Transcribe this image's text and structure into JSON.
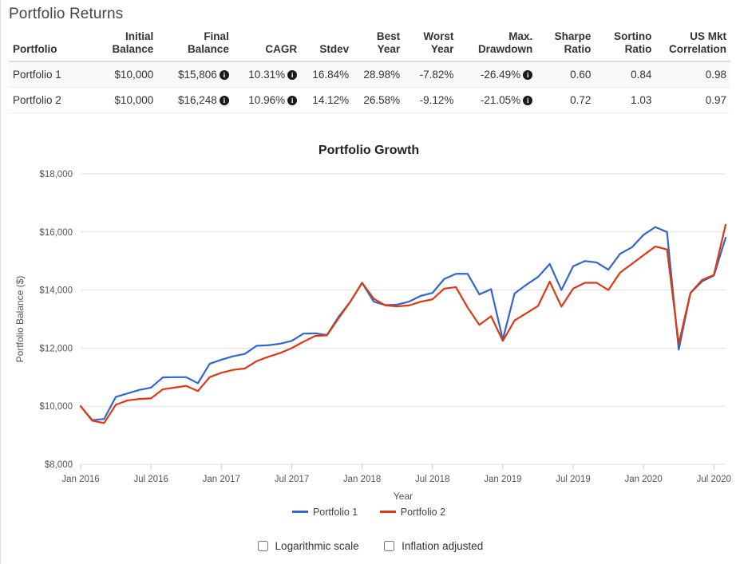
{
  "page": {
    "title": "Portfolio Returns"
  },
  "table": {
    "columns": [
      {
        "key": "portfolio",
        "label": "Portfolio",
        "align": "left"
      },
      {
        "key": "initial_balance",
        "label": "Initial\nBalance",
        "align": "right"
      },
      {
        "key": "final_balance",
        "label": "Final\nBalance",
        "align": "right"
      },
      {
        "key": "cagr",
        "label": "CAGR",
        "align": "right"
      },
      {
        "key": "stdev",
        "label": "Stdev",
        "align": "right"
      },
      {
        "key": "best_year",
        "label": "Best\nYear",
        "align": "right"
      },
      {
        "key": "worst_year",
        "label": "Worst\nYear",
        "align": "right"
      },
      {
        "key": "max_drawdown",
        "label": "Max.\nDrawdown",
        "align": "right"
      },
      {
        "key": "sharpe_ratio",
        "label": "Sharpe\nRatio",
        "align": "right"
      },
      {
        "key": "sortino_ratio",
        "label": "Sortino\nRatio",
        "align": "right"
      },
      {
        "key": "us_mkt_correlation",
        "label": "US Mkt\nCorrelation",
        "align": "right"
      }
    ],
    "rows": [
      {
        "portfolio": "Portfolio 1",
        "initial_balance": "$10,000",
        "final_balance": "$15,806",
        "final_balance_info": true,
        "cagr": "10.31%",
        "cagr_info": true,
        "stdev": "16.84%",
        "best_year": "28.98%",
        "worst_year": "-7.82%",
        "max_drawdown": "-26.49%",
        "max_drawdown_info": true,
        "sharpe_ratio": "0.60",
        "sortino_ratio": "0.84",
        "us_mkt_correlation": "0.98"
      },
      {
        "portfolio": "Portfolio 2",
        "initial_balance": "$10,000",
        "final_balance": "$16,248",
        "final_balance_info": true,
        "cagr": "10.96%",
        "cagr_info": true,
        "stdev": "14.12%",
        "best_year": "26.58%",
        "worst_year": "-9.12%",
        "max_drawdown": "-21.05%",
        "max_drawdown_info": true,
        "sharpe_ratio": "0.72",
        "sortino_ratio": "1.03",
        "us_mkt_correlation": "0.97"
      }
    ],
    "info_icon_glyph": "i",
    "info_icon_name": "info-icon"
  },
  "chart_data": {
    "type": "line",
    "title": "Portfolio Growth",
    "xlabel": "Year",
    "ylabel": "Portfolio Balance ($)",
    "ylim": [
      8000,
      18000
    ],
    "yticks": [
      8000,
      10000,
      12000,
      14000,
      16000,
      18000
    ],
    "ytick_labels": [
      "$8,000",
      "$10,000",
      "$12,000",
      "$14,000",
      "$16,000",
      "$18,000"
    ],
    "grid": true,
    "legend_position": "bottom",
    "xtick_labels": [
      "Jan 2016",
      "Jul 2016",
      "Jan 2017",
      "Jul 2017",
      "Jan 2018",
      "Jul 2018",
      "Jan 2019",
      "Jul 2019",
      "Jan 2020",
      "Jul 2020"
    ],
    "xtick_indices": [
      0,
      6,
      12,
      18,
      24,
      30,
      36,
      42,
      48,
      54
    ],
    "x": [
      "Jan 2016",
      "Feb 2016",
      "Mar 2016",
      "Apr 2016",
      "May 2016",
      "Jun 2016",
      "Jul 2016",
      "Aug 2016",
      "Sep 2016",
      "Oct 2016",
      "Nov 2016",
      "Dec 2016",
      "Jan 2017",
      "Feb 2017",
      "Mar 2017",
      "Apr 2017",
      "May 2017",
      "Jun 2017",
      "Jul 2017",
      "Aug 2017",
      "Sep 2017",
      "Oct 2017",
      "Nov 2017",
      "Dec 2017",
      "Jan 2018",
      "Feb 2018",
      "Mar 2018",
      "Apr 2018",
      "May 2018",
      "Jun 2018",
      "Jul 2018",
      "Aug 2018",
      "Sep 2018",
      "Oct 2018",
      "Nov 2018",
      "Dec 2018",
      "Jan 2019",
      "Feb 2019",
      "Mar 2019",
      "Apr 2019",
      "May 2019",
      "Jun 2019",
      "Jul 2019",
      "Aug 2019",
      "Sep 2019",
      "Oct 2019",
      "Nov 2019",
      "Dec 2019",
      "Jan 2020",
      "Feb 2020",
      "Mar 2020",
      "Apr 2020",
      "May 2020",
      "Jun 2020",
      "Jul 2020",
      "Aug 2020"
    ],
    "series": [
      {
        "name": "Portfolio 1",
        "color": "#3366cc",
        "values": [
          10000,
          9520,
          9560,
          10320,
          10440,
          10560,
          10640,
          10990,
          11000,
          11000,
          10790,
          11460,
          11600,
          11720,
          11800,
          12080,
          12100,
          12150,
          12250,
          12500,
          12510,
          12450,
          13080,
          13600,
          14250,
          13600,
          13480,
          13500,
          13600,
          13800,
          13900,
          14380,
          14560,
          14560,
          13850,
          14030,
          12300,
          13880,
          14180,
          14450,
          14900,
          14000,
          14820,
          15000,
          14950,
          14700,
          15250,
          15470,
          15900,
          16170,
          16000,
          11950,
          13900,
          14300,
          14500,
          15800
        ]
      },
      {
        "name": "Portfolio 2",
        "color": "#dc3912",
        "values": [
          10000,
          9500,
          9420,
          10050,
          10200,
          10250,
          10270,
          10580,
          10640,
          10700,
          10520,
          11000,
          11150,
          11250,
          11300,
          11550,
          11700,
          11830,
          12000,
          12220,
          12420,
          12440,
          13030,
          13600,
          14250,
          13700,
          13470,
          13440,
          13470,
          13600,
          13680,
          14050,
          14100,
          13400,
          12800,
          13100,
          12250,
          12950,
          13200,
          13450,
          14290,
          13430,
          14050,
          14250,
          14250,
          14000,
          14600,
          14900,
          15200,
          15500,
          15400,
          12150,
          13900,
          14350,
          14520,
          16248
        ]
      }
    ]
  },
  "chart_options": {
    "logarithmic_scale": {
      "label": "Logarithmic scale",
      "checked": false
    },
    "inflation_adjusted": {
      "label": "Inflation adjusted",
      "checked": false
    }
  }
}
